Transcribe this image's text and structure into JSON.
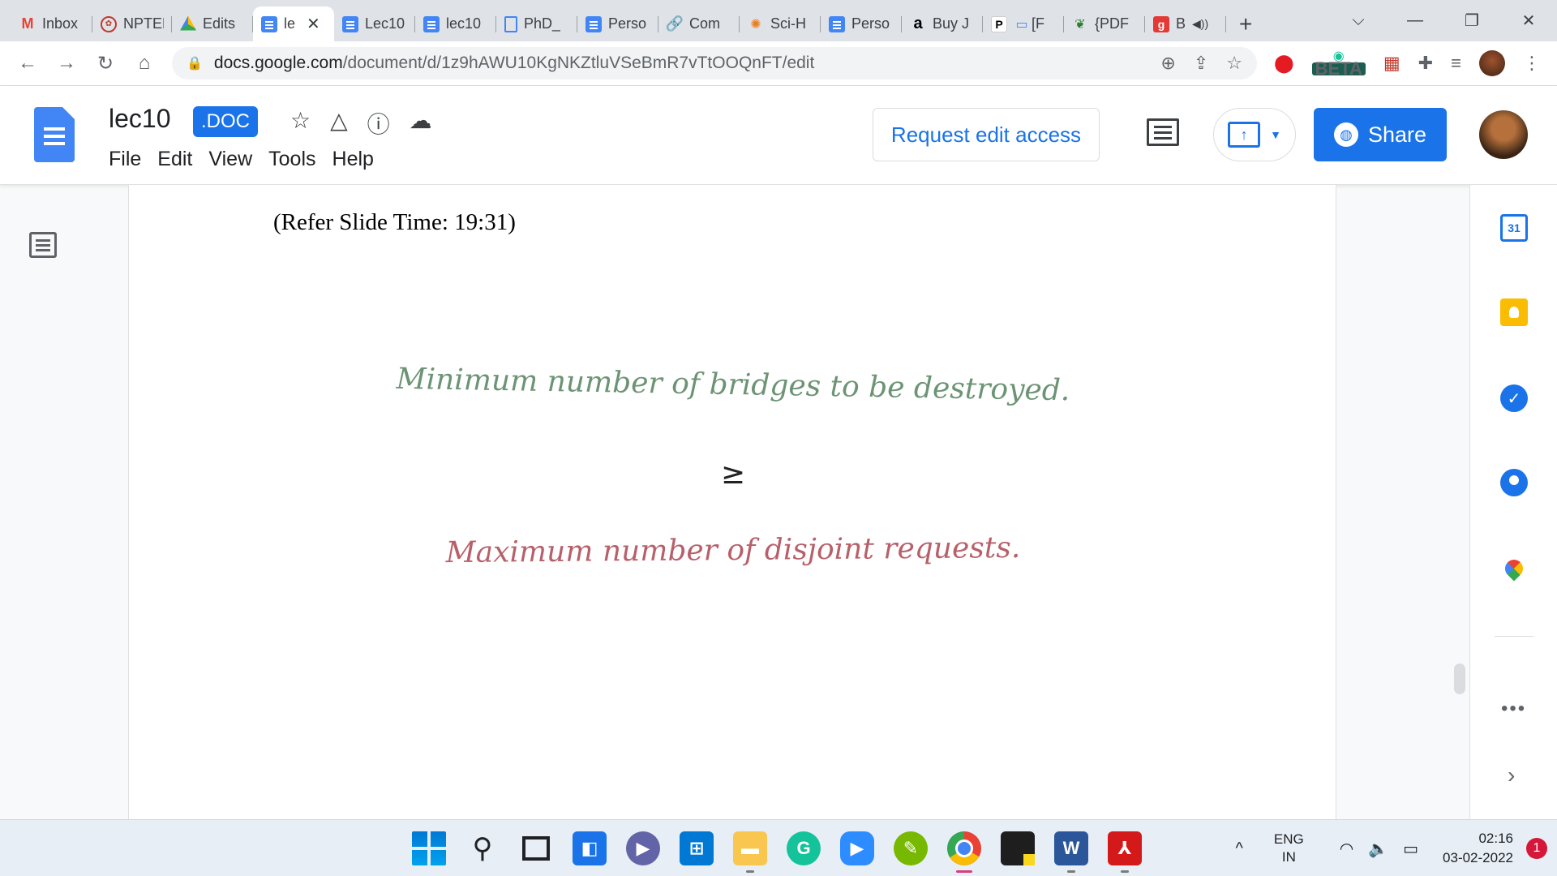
{
  "browser": {
    "tabs": [
      {
        "label": "Inbox",
        "icon": "gmail-icon",
        "color": "#ea4335"
      },
      {
        "label": "NPTEL",
        "icon": "nptel-icon",
        "color": "#c0392b"
      },
      {
        "label": "Edits",
        "icon": "drive-icon",
        "color": "#34a853"
      },
      {
        "label": "le",
        "icon": "docs-icon",
        "active": true
      },
      {
        "label": "Lec10",
        "icon": "docs-icon"
      },
      {
        "label": "lec10",
        "icon": "docs-icon"
      },
      {
        "label": "PhD_",
        "icon": "file-icon"
      },
      {
        "label": "Perso",
        "icon": "docs-icon"
      },
      {
        "label": "Com",
        "icon": "link-icon"
      },
      {
        "label": "Sci-H",
        "icon": "scihub-icon"
      },
      {
        "label": "Perso",
        "icon": "docs-icon"
      },
      {
        "label": "Buy J",
        "icon": "amazon-icon"
      },
      {
        "label": "[F",
        "icon": "book-icon",
        "prefix": "P"
      },
      {
        "label": "{PDF",
        "icon": "bamboo-icon"
      },
      {
        "label": "B",
        "icon": "goodreads-icon",
        "audio": true
      }
    ],
    "url_host": "docs.google.com",
    "url_path": "/document/d/1z9hAWU10KgNKZtluVSeBmR7vTtOOQnFT/edit",
    "beta_label": "BETA"
  },
  "docs": {
    "title": "lec10",
    "badge": ".DOC",
    "menu": [
      "File",
      "Edit",
      "View",
      "Tools",
      "Help"
    ],
    "request_edit": "Request edit access",
    "share_label": "Share",
    "accent": "#1a73e8"
  },
  "content": {
    "refer": "(Refer Slide Time: 19:31)",
    "slide_line1": "Minimum number of bridges to be destroyed.",
    "slide_geq": "≥",
    "slide_line2": "Maximum number of disjoint requests.",
    "line1_color": "#6c9474",
    "line2_color": "#b8606a"
  },
  "sidepanel": {
    "calendar_day": "31"
  },
  "taskbar": {
    "lang_top": "ENG",
    "lang_bottom": "IN",
    "time": "02:16",
    "date": "03-02-2022",
    "notifications": "1"
  }
}
